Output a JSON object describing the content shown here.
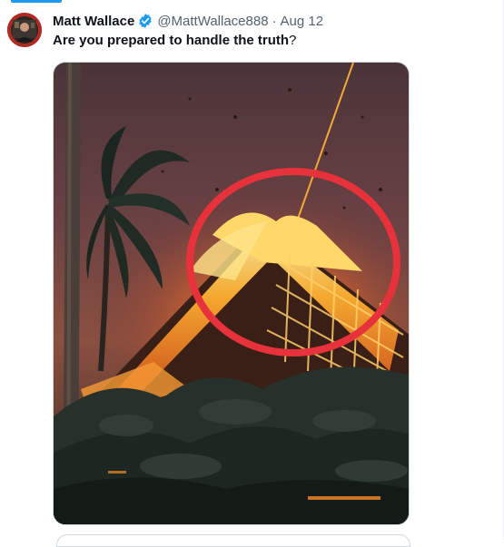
{
  "tweet": {
    "author_name": "Matt Wallace",
    "handle": "@MattWallace888",
    "separator": "·",
    "timestamp": "Aug 12",
    "text_bold": "Are you prepared to handle the truth",
    "text_rest": "?"
  },
  "icons": {
    "verified": "verified-badge-icon",
    "avatar": "profile-avatar"
  },
  "colors": {
    "text_primary": "#0f1419",
    "text_secondary": "#536471",
    "verified_blue": "#1d9bf0",
    "highlight_circle": "#e8323b"
  }
}
